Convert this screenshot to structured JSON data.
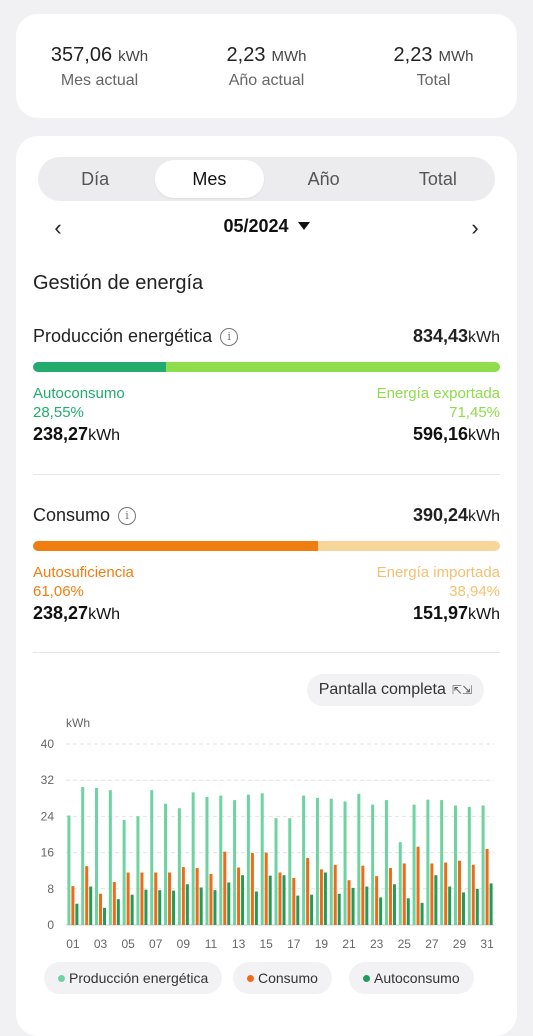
{
  "summary": {
    "month": {
      "value": "357,06",
      "unit": "kWh",
      "label": "Mes actual"
    },
    "year": {
      "value": "2,23",
      "unit": "MWh",
      "label": "Año actual"
    },
    "total": {
      "value": "2,23",
      "unit": "MWh",
      "label": "Total"
    }
  },
  "tabs": [
    {
      "label": "Día",
      "active": false
    },
    {
      "label": "Mes",
      "active": true
    },
    {
      "label": "Año",
      "active": false
    },
    {
      "label": "Total",
      "active": false
    }
  ],
  "period": {
    "label": "05/2024",
    "prev_icon": "chevron-left-icon",
    "next_icon": "chevron-right-icon"
  },
  "section_title": "Gestión de energía",
  "production": {
    "label": "Producción energética",
    "total": "834,43",
    "unit": "kWh",
    "self_fraction": 0.2855,
    "self_color": "#23ab6e",
    "export_color": "#8fdc4c",
    "left": {
      "name": "Autoconsumo",
      "pct": "28,55%",
      "value": "238,27",
      "unit": "kWh"
    },
    "right": {
      "name": "Energía exportada",
      "pct": "71,45%",
      "value": "596,16",
      "unit": "kWh"
    }
  },
  "consumption": {
    "label": "Consumo",
    "total": "390,24",
    "unit": "kWh",
    "self_fraction": 0.6106,
    "self_color": "#f07d0f",
    "import_color": "#f8d69a",
    "left": {
      "name": "Autosuficiencia",
      "pct": "61,06%",
      "value": "238,27",
      "unit": "kWh"
    },
    "right": {
      "name": "Energía importada",
      "pct": "38,94%",
      "value": "151,97",
      "unit": "kWh"
    }
  },
  "fullscreen_label": "Pantalla completa",
  "legend": [
    {
      "label": "Producción energética",
      "color": "#6dd3a1"
    },
    {
      "label": "Consumo",
      "color": "#ee6b1a"
    },
    {
      "label": "Autoconsumo",
      "color": "#1f9c5a"
    }
  ],
  "chart_data": {
    "type": "bar",
    "ylabel": "kWh",
    "ylim": [
      0,
      40
    ],
    "yticks": [
      0,
      8,
      16,
      24,
      32,
      40
    ],
    "categories": [
      "01",
      "02",
      "03",
      "04",
      "05",
      "06",
      "07",
      "08",
      "09",
      "10",
      "11",
      "12",
      "13",
      "14",
      "15",
      "16",
      "17",
      "18",
      "19",
      "20",
      "21",
      "22",
      "23",
      "24",
      "25",
      "26",
      "27",
      "28",
      "29",
      "30",
      "31"
    ],
    "x_tick_labels": [
      "01",
      "03",
      "05",
      "07",
      "09",
      "11",
      "13",
      "15",
      "17",
      "19",
      "21",
      "23",
      "25",
      "27",
      "29",
      "31"
    ],
    "grid": true,
    "series": [
      {
        "name": "Producción energética",
        "color": "#6dd3a1",
        "values": [
          24.2,
          30.5,
          30.3,
          29.8,
          23.2,
          24.0,
          29.8,
          26.8,
          25.8,
          29.3,
          28.3,
          28.6,
          27.6,
          28.8,
          29.1,
          23.6,
          23.6,
          28.6,
          28.1,
          27.9,
          27.3,
          29.0,
          26.6,
          27.6,
          18.3,
          26.6,
          27.7,
          27.6,
          26.4,
          26.1,
          26.4
        ]
      },
      {
        "name": "Consumo",
        "color": "#ee6b1a",
        "values": [
          8.6,
          13.0,
          6.9,
          9.5,
          11.6,
          11.6,
          11.6,
          11.6,
          12.8,
          12.6,
          11.3,
          16.2,
          12.7,
          15.9,
          16.0,
          11.6,
          10.4,
          14.8,
          12.3,
          13.3,
          9.9,
          13.1,
          10.8,
          12.6,
          13.6,
          17.3,
          13.6,
          13.8,
          14.2,
          13.3,
          16.8
        ]
      },
      {
        "name": "Autoconsumo",
        "color": "#1f9c5a",
        "values": [
          4.7,
          8.5,
          3.8,
          5.7,
          6.7,
          7.8,
          7.7,
          7.6,
          9.0,
          8.3,
          7.7,
          9.4,
          11.0,
          7.4,
          10.9,
          11.0,
          6.5,
          6.7,
          11.6,
          6.9,
          8.2,
          8.5,
          6.1,
          9.0,
          5.9,
          4.9,
          11.0,
          8.5,
          7.2,
          8.0,
          9.2
        ]
      }
    ]
  }
}
